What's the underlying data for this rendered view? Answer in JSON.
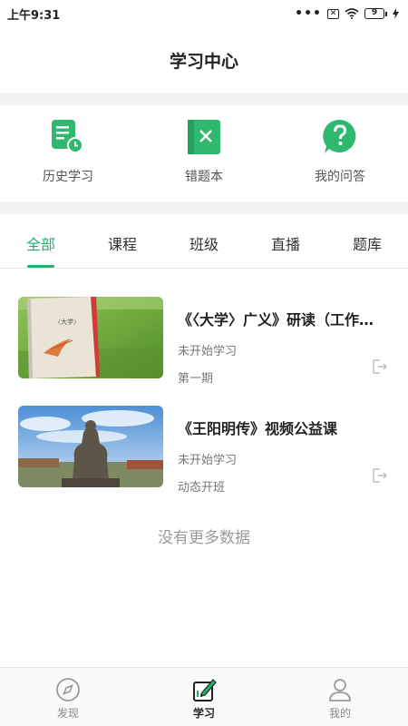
{
  "status_bar": {
    "time": "上午9:31",
    "dots": "•••",
    "sim": "✕",
    "battery": "9"
  },
  "header": {
    "title": "学习中心"
  },
  "quick_access": [
    {
      "label": "历史学习",
      "icon": "history-doc-icon"
    },
    {
      "label": "错题本",
      "icon": "wrong-notebook-icon"
    },
    {
      "label": "我的问答",
      "icon": "question-bubble-icon"
    }
  ],
  "tabs": [
    {
      "label": "全部",
      "active": true
    },
    {
      "label": "课程",
      "active": false
    },
    {
      "label": "班级",
      "active": false
    },
    {
      "label": "直播",
      "active": false
    },
    {
      "label": "题库",
      "active": false
    }
  ],
  "courses": [
    {
      "title": "《〈大学〉广义》研读（工作…",
      "status": "未开始学习",
      "term": "第一期",
      "thumbnail": "book-on-grass-photo"
    },
    {
      "title": "《王阳明传》视频公益课",
      "status": "未开始学习",
      "term": "动态开班",
      "thumbnail": "statue-photo"
    }
  ],
  "no_more_text": "没有更多数据",
  "bottom_nav": [
    {
      "label": "发现",
      "icon": "compass-icon",
      "active": false
    },
    {
      "label": "学习",
      "icon": "study-pen-icon",
      "active": true
    },
    {
      "label": "我的",
      "icon": "person-icon",
      "active": false
    }
  ],
  "colors": {
    "accent": "#23b06b",
    "band": "#f2f2f2"
  }
}
